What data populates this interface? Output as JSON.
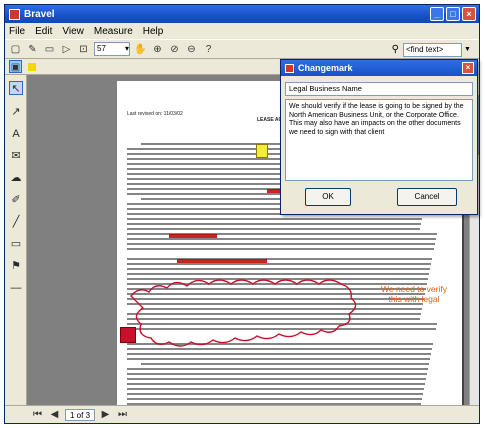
{
  "window": {
    "title": "Bravel"
  },
  "menu": [
    "File",
    "Edit",
    "View",
    "Measure",
    "Help"
  ],
  "toolbar": {
    "page_value": "57",
    "find_placeholder": "<find text>"
  },
  "statusbar": {
    "page_info": "1 of 3"
  },
  "dialog": {
    "title": "Changemark",
    "name": "Legal Business Name",
    "comment": "We should verify if the lease is going to be signed by the North American Business Unit, or the Corporate Office. This may also have an impacts on the other documents we need to sign with that client",
    "ok": "OK",
    "cancel": "Cancel"
  },
  "document": {
    "revision": "Last revised on: 11/03/02",
    "heading": "LEASE AGREEMENT"
  },
  "annotation": {
    "text": "We need to verify this with legal",
    "color": "#e06020"
  },
  "colors": {
    "titlebar": "#1751c8",
    "highlight": "#b80000",
    "cloud": "#c8102e",
    "sticky": "#f4ec3c"
  }
}
